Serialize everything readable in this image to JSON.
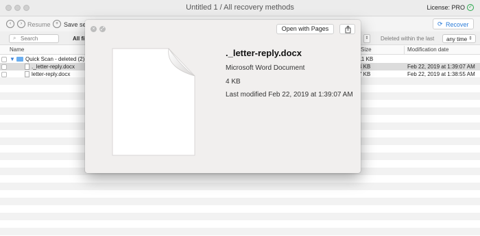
{
  "window": {
    "title": "Untitled 1 / All recovery methods",
    "license": "License: PRO"
  },
  "toolbar": {
    "resume_label": "Resume",
    "save_session_label": "Save ses",
    "recover_label": "Recover"
  },
  "filter": {
    "search_placeholder": "Search",
    "all_files_label": "All fil",
    "deleted_label": "Deleted within the last",
    "time_value": "any time"
  },
  "table": {
    "columns": {
      "name": "Name",
      "size": "Size",
      "modified": "Modification date"
    },
    "rows": [
      {
        "name": "Quick Scan - deleted (2)",
        "size": "11 KB",
        "modified": ""
      },
      {
        "name": "._letter-reply.docx",
        "size": "4 KB",
        "modified": "Feb 22, 2019 at 1:39:07 AM"
      },
      {
        "name": "letter-reply.docx",
        "size": "7 KB",
        "modified": "Feb 22, 2019 at 1:38:55 AM"
      }
    ]
  },
  "quicklook": {
    "open_with_label": "Open with Pages",
    "file_name": "._letter-reply.docx",
    "kind": "Microsoft Word Document",
    "size": "4 KB",
    "modified": "Last modified Feb 22, 2019 at 1:39:07 AM"
  },
  "colors": {
    "accent": "#2a7bd8",
    "selection": "#dcdcdc",
    "popup_bg": "#f1efee"
  },
  "icons": [
    "back-icon",
    "resume-icon",
    "save-icon",
    "recover-icon",
    "search-icon",
    "folder-icon",
    "document-icon",
    "close-icon",
    "share-icon",
    "license-check-icon"
  ]
}
